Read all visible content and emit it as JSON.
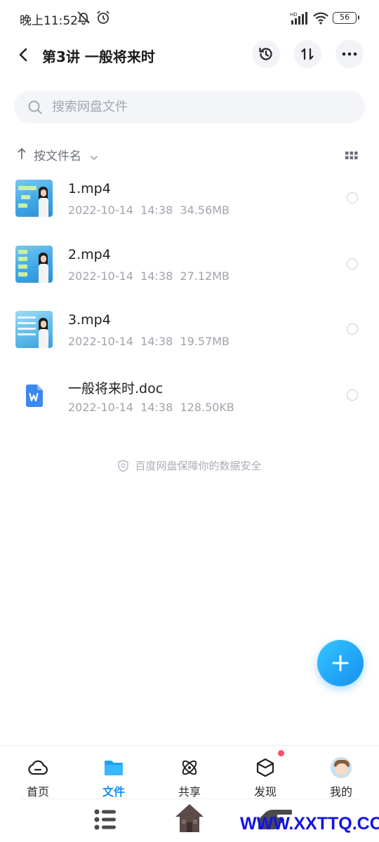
{
  "status_bar": {
    "time": "晚上11:52",
    "battery": "56",
    "network_badge": "HD"
  },
  "header": {
    "title": "第3讲 一般将来时"
  },
  "search": {
    "placeholder": "搜索网盘文件"
  },
  "sort": {
    "label": "按文件名"
  },
  "files": [
    {
      "name": "1.mp4",
      "date": "2022-10-14",
      "time": "14:38",
      "size": "34.56MB",
      "type": "video"
    },
    {
      "name": "2.mp4",
      "date": "2022-10-14",
      "time": "14:38",
      "size": "27.12MB",
      "type": "video"
    },
    {
      "name": "3.mp4",
      "date": "2022-10-14",
      "time": "14:38",
      "size": "19.57MB",
      "type": "video"
    },
    {
      "name": "一般将来时.doc",
      "date": "2022-10-14",
      "time": "14:38",
      "size": "128.50KB",
      "type": "doc"
    }
  ],
  "safety_note": "百度网盘保障你的数据安全",
  "tabs": [
    {
      "label": "首页",
      "icon": "cloud-icon"
    },
    {
      "label": "文件",
      "icon": "folder-icon",
      "active": true
    },
    {
      "label": "共享",
      "icon": "atom-icon"
    },
    {
      "label": "发现",
      "icon": "cube-icon",
      "badge_dot": true
    },
    {
      "label": "我的",
      "icon": "avatar"
    }
  ],
  "watermark": "WWW.XXTTQ.COM",
  "colors": {
    "accent": "#1590f2",
    "badge": "#ff4d6a",
    "muted_text": "#a0a4ac"
  }
}
